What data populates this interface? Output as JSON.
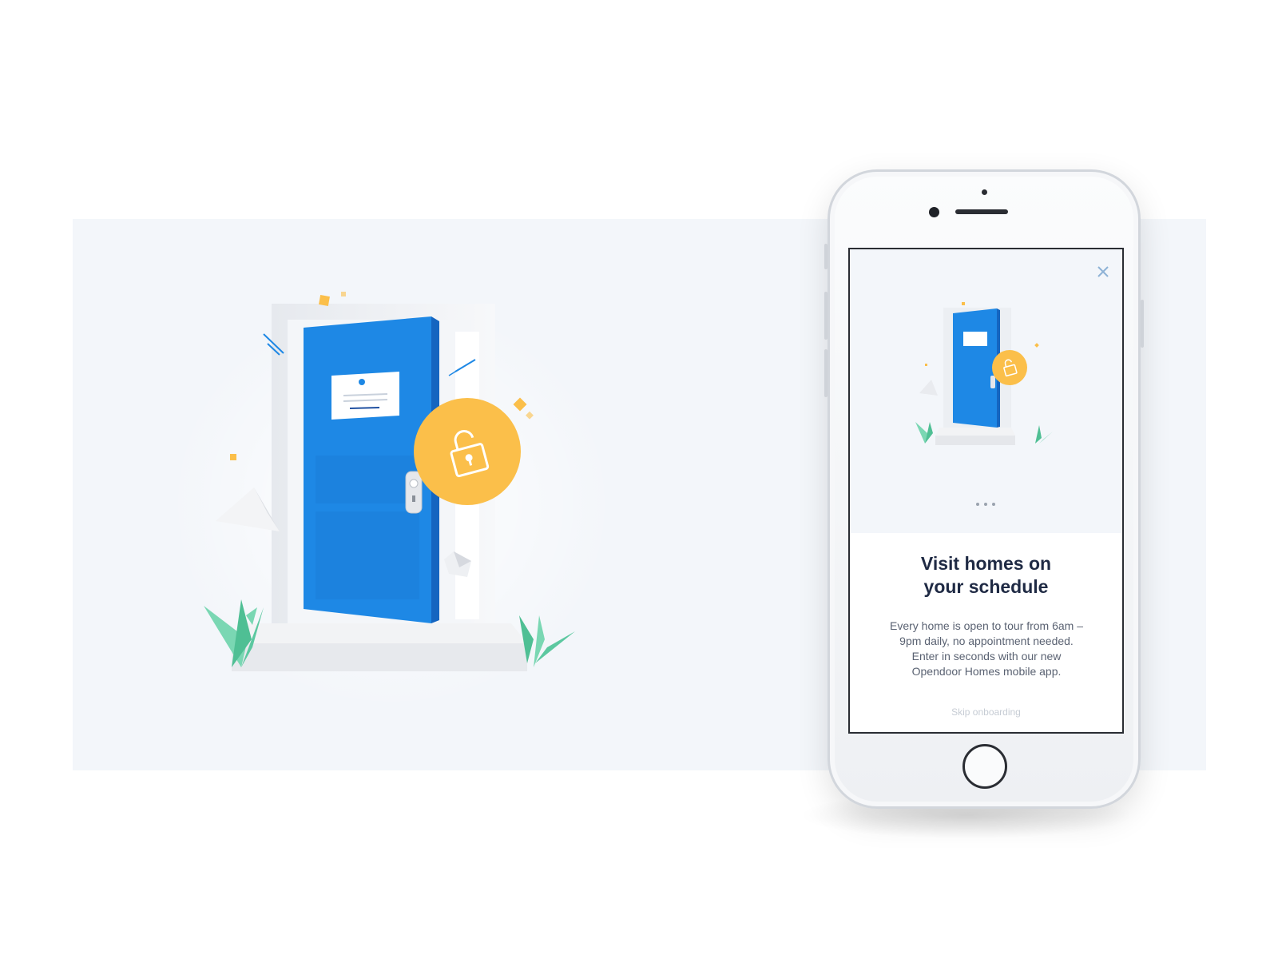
{
  "colors": {
    "band": "#f3f6fa",
    "door": "#1e88e5",
    "door_edge": "#1565c0",
    "lock_circle": "#fbbf4a",
    "leaf": "#5cc8a0",
    "title": "#1f2a44",
    "body": "#5a6272",
    "skip": "#c6ccd4"
  },
  "hero_illustration": {
    "icons": [
      "door-icon",
      "lock-icon",
      "leaf-icon",
      "pyramid-icon",
      "cube-icon"
    ]
  },
  "phone": {
    "close_icon": "close-icon",
    "onboarding": {
      "title": "Visit homes on your schedule",
      "body": "Every home is open to tour from 6am – 9pm daily, no appointment needed. Enter in seconds with our new Opendoor Homes mobile app.",
      "skip_label": "Skip onboarding",
      "page_count": 3
    }
  }
}
